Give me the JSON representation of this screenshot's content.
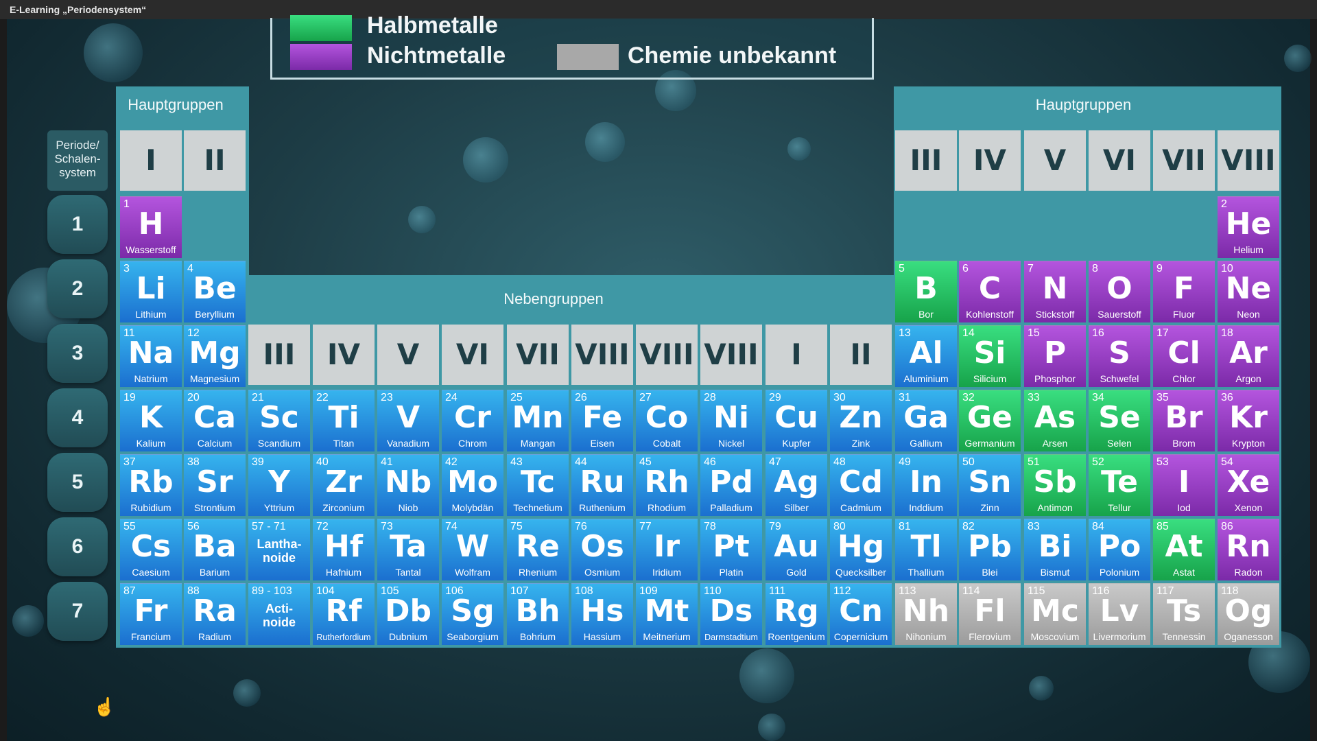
{
  "window": {
    "title": "E-Learning „Periodensystem“"
  },
  "legend": [
    {
      "label": "Halbmetalle",
      "color": "#2ecc71"
    },
    {
      "label": "Nichtmetalle",
      "color": "#9b3fc9"
    },
    {
      "label": "Chemie unbekannt",
      "color": "#a8a8a8"
    }
  ],
  "headers": {
    "left_main": "Hauptgruppen",
    "right_main": "Hauptgruppen",
    "sub": "Nebengruppen",
    "period": "Periode/ Schalen- system"
  },
  "groups": {
    "left": [
      "I",
      "II"
    ],
    "sub": [
      "III",
      "IV",
      "V",
      "VI",
      "VII",
      "VIII",
      "VIII",
      "VIII",
      "I",
      "II"
    ],
    "right": [
      "III",
      "IV",
      "V",
      "VI",
      "VII",
      "VIII"
    ]
  },
  "periods": [
    "1",
    "2",
    "3",
    "4",
    "5",
    "6",
    "7"
  ],
  "colors": {
    "metal": "#2a93e0",
    "halbmetall": "#2ecc71",
    "nichtmetall": "#9b3fc9",
    "unbekannt": "#a8a8a8"
  },
  "elements": [
    {
      "n": "1",
      "s": "H",
      "name": "Wasserstoff",
      "t": "non",
      "c": 0,
      "r": 0
    },
    {
      "n": "2",
      "s": "He",
      "name": "Helium",
      "t": "non",
      "c": 17,
      "r": 0
    },
    {
      "n": "3",
      "s": "Li",
      "name": "Lithium",
      "t": "metal",
      "c": 0,
      "r": 1
    },
    {
      "n": "4",
      "s": "Be",
      "name": "Beryllium",
      "t": "metal",
      "c": 1,
      "r": 1
    },
    {
      "n": "5",
      "s": "B",
      "name": "Bor",
      "t": "half",
      "c": 12,
      "r": 1
    },
    {
      "n": "6",
      "s": "C",
      "name": "Kohlenstoff",
      "t": "non",
      "c": 13,
      "r": 1
    },
    {
      "n": "7",
      "s": "N",
      "name": "Stickstoff",
      "t": "non",
      "c": 14,
      "r": 1
    },
    {
      "n": "8",
      "s": "O",
      "name": "Sauerstoff",
      "t": "non",
      "c": 15,
      "r": 1
    },
    {
      "n": "9",
      "s": "F",
      "name": "Fluor",
      "t": "non",
      "c": 16,
      "r": 1
    },
    {
      "n": "10",
      "s": "Ne",
      "name": "Neon",
      "t": "non",
      "c": 17,
      "r": 1
    },
    {
      "n": "11",
      "s": "Na",
      "name": "Natrium",
      "t": "metal",
      "c": 0,
      "r": 2
    },
    {
      "n": "12",
      "s": "Mg",
      "name": "Magnesium",
      "t": "metal",
      "c": 1,
      "r": 2
    },
    {
      "n": "13",
      "s": "Al",
      "name": "Aluminium",
      "t": "metal",
      "c": 12,
      "r": 2
    },
    {
      "n": "14",
      "s": "Si",
      "name": "Silicium",
      "t": "half",
      "c": 13,
      "r": 2
    },
    {
      "n": "15",
      "s": "P",
      "name": "Phosphor",
      "t": "non",
      "c": 14,
      "r": 2
    },
    {
      "n": "16",
      "s": "S",
      "name": "Schwefel",
      "t": "non",
      "c": 15,
      "r": 2
    },
    {
      "n": "17",
      "s": "Cl",
      "name": "Chlor",
      "t": "non",
      "c": 16,
      "r": 2
    },
    {
      "n": "18",
      "s": "Ar",
      "name": "Argon",
      "t": "non",
      "c": 17,
      "r": 2
    },
    {
      "n": "19",
      "s": "K",
      "name": "Kalium",
      "t": "metal",
      "c": 0,
      "r": 3
    },
    {
      "n": "20",
      "s": "Ca",
      "name": "Calcium",
      "t": "metal",
      "c": 1,
      "r": 3
    },
    {
      "n": "21",
      "s": "Sc",
      "name": "Scandium",
      "t": "metal",
      "c": 2,
      "r": 3
    },
    {
      "n": "22",
      "s": "Ti",
      "name": "Titan",
      "t": "metal",
      "c": 3,
      "r": 3
    },
    {
      "n": "23",
      "s": "V",
      "name": "Vanadium",
      "t": "metal",
      "c": 4,
      "r": 3
    },
    {
      "n": "24",
      "s": "Cr",
      "name": "Chrom",
      "t": "metal",
      "c": 5,
      "r": 3
    },
    {
      "n": "25",
      "s": "Mn",
      "name": "Mangan",
      "t": "metal",
      "c": 6,
      "r": 3
    },
    {
      "n": "26",
      "s": "Fe",
      "name": "Eisen",
      "t": "metal",
      "c": 7,
      "r": 3
    },
    {
      "n": "27",
      "s": "Co",
      "name": "Cobalt",
      "t": "metal",
      "c": 8,
      "r": 3
    },
    {
      "n": "28",
      "s": "Ni",
      "name": "Nickel",
      "t": "metal",
      "c": 9,
      "r": 3
    },
    {
      "n": "29",
      "s": "Cu",
      "name": "Kupfer",
      "t": "metal",
      "c": 10,
      "r": 3
    },
    {
      "n": "30",
      "s": "Zn",
      "name": "Zink",
      "t": "metal",
      "c": 11,
      "r": 3
    },
    {
      "n": "31",
      "s": "Ga",
      "name": "Gallium",
      "t": "metal",
      "c": 12,
      "r": 3
    },
    {
      "n": "32",
      "s": "Ge",
      "name": "Germanium",
      "t": "half",
      "c": 13,
      "r": 3
    },
    {
      "n": "33",
      "s": "As",
      "name": "Arsen",
      "t": "half",
      "c": 14,
      "r": 3
    },
    {
      "n": "34",
      "s": "Se",
      "name": "Selen",
      "t": "half",
      "c": 15,
      "r": 3
    },
    {
      "n": "35",
      "s": "Br",
      "name": "Brom",
      "t": "non",
      "c": 16,
      "r": 3
    },
    {
      "n": "36",
      "s": "Kr",
      "name": "Krypton",
      "t": "non",
      "c": 17,
      "r": 3
    },
    {
      "n": "37",
      "s": "Rb",
      "name": "Rubidium",
      "t": "metal",
      "c": 0,
      "r": 4
    },
    {
      "n": "38",
      "s": "Sr",
      "name": "Strontium",
      "t": "metal",
      "c": 1,
      "r": 4
    },
    {
      "n": "39",
      "s": "Y",
      "name": "Yttrium",
      "t": "metal",
      "c": 2,
      "r": 4
    },
    {
      "n": "40",
      "s": "Zr",
      "name": "Zirconium",
      "t": "metal",
      "c": 3,
      "r": 4
    },
    {
      "n": "41",
      "s": "Nb",
      "name": "Niob",
      "t": "metal",
      "c": 4,
      "r": 4
    },
    {
      "n": "42",
      "s": "Mo",
      "name": "Molybdän",
      "t": "metal",
      "c": 5,
      "r": 4
    },
    {
      "n": "43",
      "s": "Tc",
      "name": "Technetium",
      "t": "metal",
      "c": 6,
      "r": 4
    },
    {
      "n": "44",
      "s": "Ru",
      "name": "Ruthenium",
      "t": "metal",
      "c": 7,
      "r": 4
    },
    {
      "n": "45",
      "s": "Rh",
      "name": "Rhodium",
      "t": "metal",
      "c": 8,
      "r": 4
    },
    {
      "n": "46",
      "s": "Pd",
      "name": "Palladium",
      "t": "metal",
      "c": 9,
      "r": 4
    },
    {
      "n": "47",
      "s": "Ag",
      "name": "Silber",
      "t": "metal",
      "c": 10,
      "r": 4
    },
    {
      "n": "48",
      "s": "Cd",
      "name": "Cadmium",
      "t": "metal",
      "c": 11,
      "r": 4
    },
    {
      "n": "49",
      "s": "In",
      "name": "Inddium",
      "t": "metal",
      "c": 12,
      "r": 4
    },
    {
      "n": "50",
      "s": "Sn",
      "name": "Zinn",
      "t": "metal",
      "c": 13,
      "r": 4
    },
    {
      "n": "51",
      "s": "Sb",
      "name": "Antimon",
      "t": "half",
      "c": 14,
      "r": 4
    },
    {
      "n": "52",
      "s": "Te",
      "name": "Tellur",
      "t": "half",
      "c": 15,
      "r": 4
    },
    {
      "n": "53",
      "s": "I",
      "name": "Iod",
      "t": "non",
      "c": 16,
      "r": 4
    },
    {
      "n": "54",
      "s": "Xe",
      "name": "Xenon",
      "t": "non",
      "c": 17,
      "r": 4
    },
    {
      "n": "55",
      "s": "Cs",
      "name": "Caesium",
      "t": "metal",
      "c": 0,
      "r": 5
    },
    {
      "n": "56",
      "s": "Ba",
      "name": "Barium",
      "t": "metal",
      "c": 1,
      "r": 5
    },
    {
      "n": "57 - 71",
      "s": "",
      "series": "Lantha- noide",
      "name": "",
      "t": "metal",
      "c": 2,
      "r": 5
    },
    {
      "n": "72",
      "s": "Hf",
      "name": "Hafnium",
      "t": "metal",
      "c": 3,
      "r": 5
    },
    {
      "n": "73",
      "s": "Ta",
      "name": "Tantal",
      "t": "metal",
      "c": 4,
      "r": 5
    },
    {
      "n": "74",
      "s": "W",
      "name": "Wolfram",
      "t": "metal",
      "c": 5,
      "r": 5
    },
    {
      "n": "75",
      "s": "Re",
      "name": "Rhenium",
      "t": "metal",
      "c": 6,
      "r": 5
    },
    {
      "n": "76",
      "s": "Os",
      "name": "Osmium",
      "t": "metal",
      "c": 7,
      "r": 5
    },
    {
      "n": "77",
      "s": "Ir",
      "name": "Iridium",
      "t": "metal",
      "c": 8,
      "r": 5
    },
    {
      "n": "78",
      "s": "Pt",
      "name": "Platin",
      "t": "metal",
      "c": 9,
      "r": 5
    },
    {
      "n": "79",
      "s": "Au",
      "name": "Gold",
      "t": "metal",
      "c": 10,
      "r": 5
    },
    {
      "n": "80",
      "s": "Hg",
      "name": "Quecksilber",
      "t": "metal",
      "c": 11,
      "r": 5
    },
    {
      "n": "81",
      "s": "Tl",
      "name": "Thallium",
      "t": "metal",
      "c": 12,
      "r": 5
    },
    {
      "n": "82",
      "s": "Pb",
      "name": "Blei",
      "t": "metal",
      "c": 13,
      "r": 5
    },
    {
      "n": "83",
      "s": "Bi",
      "name": "Bismut",
      "t": "metal",
      "c": 14,
      "r": 5
    },
    {
      "n": "84",
      "s": "Po",
      "name": "Polonium",
      "t": "metal",
      "c": 15,
      "r": 5
    },
    {
      "n": "85",
      "s": "At",
      "name": "Astat",
      "t": "half",
      "c": 16,
      "r": 5
    },
    {
      "n": "86",
      "s": "Rn",
      "name": "Radon",
      "t": "non",
      "c": 17,
      "r": 5
    },
    {
      "n": "87",
      "s": "Fr",
      "name": "Francium",
      "t": "metal",
      "c": 0,
      "r": 6
    },
    {
      "n": "88",
      "s": "Ra",
      "name": "Radium",
      "t": "metal",
      "c": 1,
      "r": 6
    },
    {
      "n": "89 - 103",
      "s": "",
      "series": "Acti- noide",
      "name": "",
      "t": "metal",
      "c": 2,
      "r": 6
    },
    {
      "n": "104",
      "s": "Rf",
      "name": "Rutherfordium",
      "t": "metal",
      "c": 3,
      "r": 6
    },
    {
      "n": "105",
      "s": "Db",
      "name": "Dubnium",
      "t": "metal",
      "c": 4,
      "r": 6
    },
    {
      "n": "106",
      "s": "Sg",
      "name": "Seaborgium",
      "t": "metal",
      "c": 5,
      "r": 6
    },
    {
      "n": "107",
      "s": "Bh",
      "name": "Bohrium",
      "t": "metal",
      "c": 6,
      "r": 6
    },
    {
      "n": "108",
      "s": "Hs",
      "name": "Hassium",
      "t": "metal",
      "c": 7,
      "r": 6
    },
    {
      "n": "109",
      "s": "Mt",
      "name": "Meitnerium",
      "t": "metal",
      "c": 8,
      "r": 6
    },
    {
      "n": "110",
      "s": "Ds",
      "name": "Darmstadtium",
      "t": "metal",
      "c": 9,
      "r": 6
    },
    {
      "n": "111",
      "s": "Rg",
      "name": "Roentgenium",
      "t": "metal",
      "c": 10,
      "r": 6
    },
    {
      "n": "112",
      "s": "Cn",
      "name": "Copernicium",
      "t": "metal",
      "c": 11,
      "r": 6
    },
    {
      "n": "113",
      "s": "Nh",
      "name": "Nihonium",
      "t": "unk",
      "c": 12,
      "r": 6
    },
    {
      "n": "114",
      "s": "Fl",
      "name": "Flerovium",
      "t": "unk",
      "c": 13,
      "r": 6
    },
    {
      "n": "115",
      "s": "Mc",
      "name": "Moscovium",
      "t": "unk",
      "c": 14,
      "r": 6
    },
    {
      "n": "116",
      "s": "Lv",
      "name": "Livermorium",
      "t": "unk",
      "c": 15,
      "r": 6
    },
    {
      "n": "117",
      "s": "Ts",
      "name": "Tennessin",
      "t": "unk",
      "c": 16,
      "r": 6
    },
    {
      "n": "118",
      "s": "Og",
      "name": "Oganesson",
      "t": "unk",
      "c": 17,
      "r": 6
    }
  ]
}
